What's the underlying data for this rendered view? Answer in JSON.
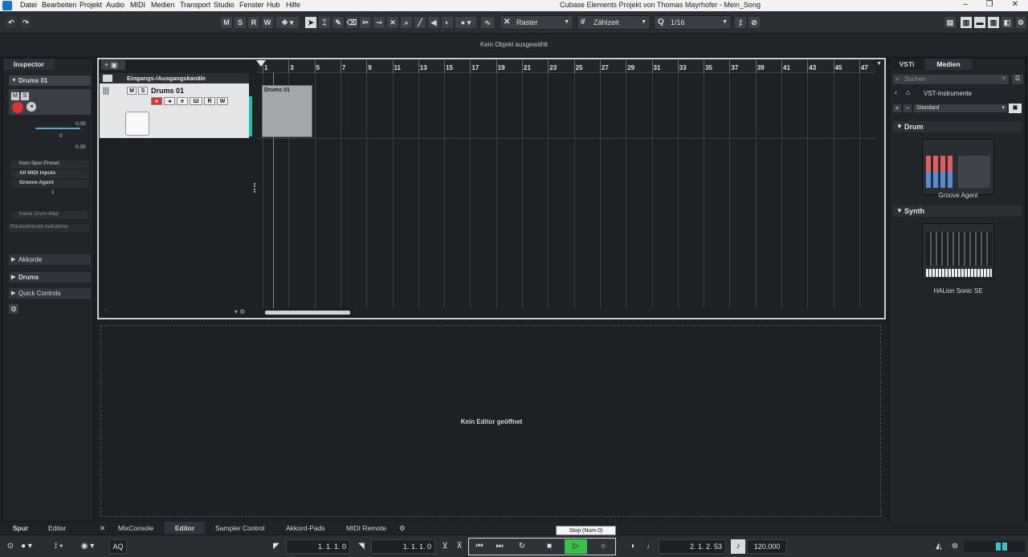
{
  "window": {
    "title": "Cubase Elements Projekt von Thomas Mayrhofer - Mein_Song",
    "controls": [
      "–",
      "❐",
      "✕"
    ]
  },
  "menu": [
    "Datei",
    "Bearbeiten",
    "Projekt",
    "Audio",
    "MIDI",
    "Medien",
    "Transport",
    "Studio",
    "Fenster",
    "Hub",
    "Hilfe"
  ],
  "toolbar": {
    "msrw": [
      "M",
      "S",
      "R",
      "W"
    ],
    "snap_type": "Raster",
    "grid_type": "Zählzeit",
    "quantize": "1/16"
  },
  "infoline": "Kein Objekt ausgewählt",
  "inspector": {
    "tab": "Inspector",
    "track_name": "Drums 01",
    "volume": "0.00",
    "pan": "0",
    "delay": "0.00",
    "preset": "Kein Spur-Preset",
    "input": "All MIDI Inputs",
    "output": "Groove Agent",
    "channel": "1",
    "drum_map": "Keine Drum-Map",
    "retro_record": "Rückwirkende Aufnahme",
    "sections": [
      "Akkorde",
      "Drums",
      "Quick Controls"
    ]
  },
  "project": {
    "folder_track": "Eingangs-/Ausgangskanäle",
    "track": {
      "name": "Drums 01",
      "buttons": [
        "M",
        "S",
        "R",
        "W"
      ]
    },
    "part_name": "Drums 01",
    "ruler": [
      "1",
      "3",
      "5",
      "7",
      "9",
      "11",
      "13",
      "15",
      "17",
      "19",
      "21",
      "23",
      "25",
      "27",
      "29",
      "31",
      "33",
      "35",
      "37",
      "39",
      "41",
      "43",
      "45",
      "47"
    ]
  },
  "lower_zone": {
    "message": "Kein Editor geöffnet"
  },
  "right_zone": {
    "tabs": [
      "VSTi",
      "Medien"
    ],
    "search_placeholder": "Suchen",
    "breadcrumb": "VST-Instrumente",
    "filter": "Standard",
    "categories": [
      {
        "name": "Drum",
        "item": "Groove Agent"
      },
      {
        "name": "Synth",
        "item": "HALion Sonic SE"
      }
    ]
  },
  "bottom_tabs": {
    "left": [
      "Spur",
      "Editor"
    ],
    "right": [
      "MixConsole",
      "Editor",
      "Sampler Control",
      "Akkord-Pads",
      "MIDI Remote"
    ]
  },
  "transport": {
    "left_locator": "1. 1. 1.   0",
    "right_locator": "1. 1. 1.   0",
    "position": "2. 1. 2.  53",
    "tempo": "120.000",
    "aq": "AQ",
    "tooltip": "Stop (Num 0)"
  }
}
